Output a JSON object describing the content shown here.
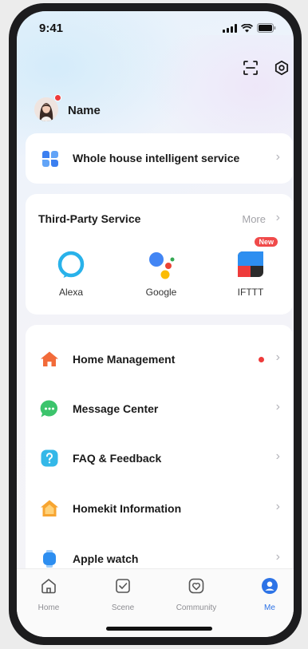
{
  "status_bar": {
    "time": "9:41"
  },
  "profile": {
    "name": "Name",
    "has_notification": true
  },
  "top_actions": {
    "scan": "scan-icon",
    "settings": "settings-icon"
  },
  "whole_house": {
    "label": "Whole house intelligent service",
    "icon": "grid-petals-icon"
  },
  "third_party": {
    "title": "Third-Party Service",
    "more_label": "More",
    "services": [
      {
        "label": "Alexa",
        "icon": "alexa-icon"
      },
      {
        "label": "Google",
        "icon": "google-assistant-icon"
      },
      {
        "label": "IFTTT",
        "icon": "ifttt-icon",
        "badge": "New"
      }
    ]
  },
  "menu": {
    "items": [
      {
        "label": "Home Management",
        "icon": "house-icon",
        "has_dot": true
      },
      {
        "label": "Message Center",
        "icon": "chat-bubble-icon"
      },
      {
        "label": "FAQ & Feedback",
        "icon": "question-icon"
      },
      {
        "label": "Homekit Information",
        "icon": "homekit-icon"
      },
      {
        "label": "Apple watch",
        "icon": "watch-icon"
      }
    ]
  },
  "tabbar": {
    "tabs": [
      {
        "label": "Home",
        "icon": "home-tab-icon"
      },
      {
        "label": "Scene",
        "icon": "scene-tab-icon"
      },
      {
        "label": "Community",
        "icon": "community-tab-icon"
      },
      {
        "label": "Me",
        "icon": "me-tab-icon",
        "active": true
      }
    ]
  },
  "colors": {
    "accent": "#2d73e6",
    "notification": "#ee3b3b",
    "home_icon": "#f26b3a",
    "message_icon": "#3cc46c",
    "faq_icon": "#34b8e8",
    "homekit_icon": "#f7a531",
    "watch_icon": "#2d8ef0"
  }
}
